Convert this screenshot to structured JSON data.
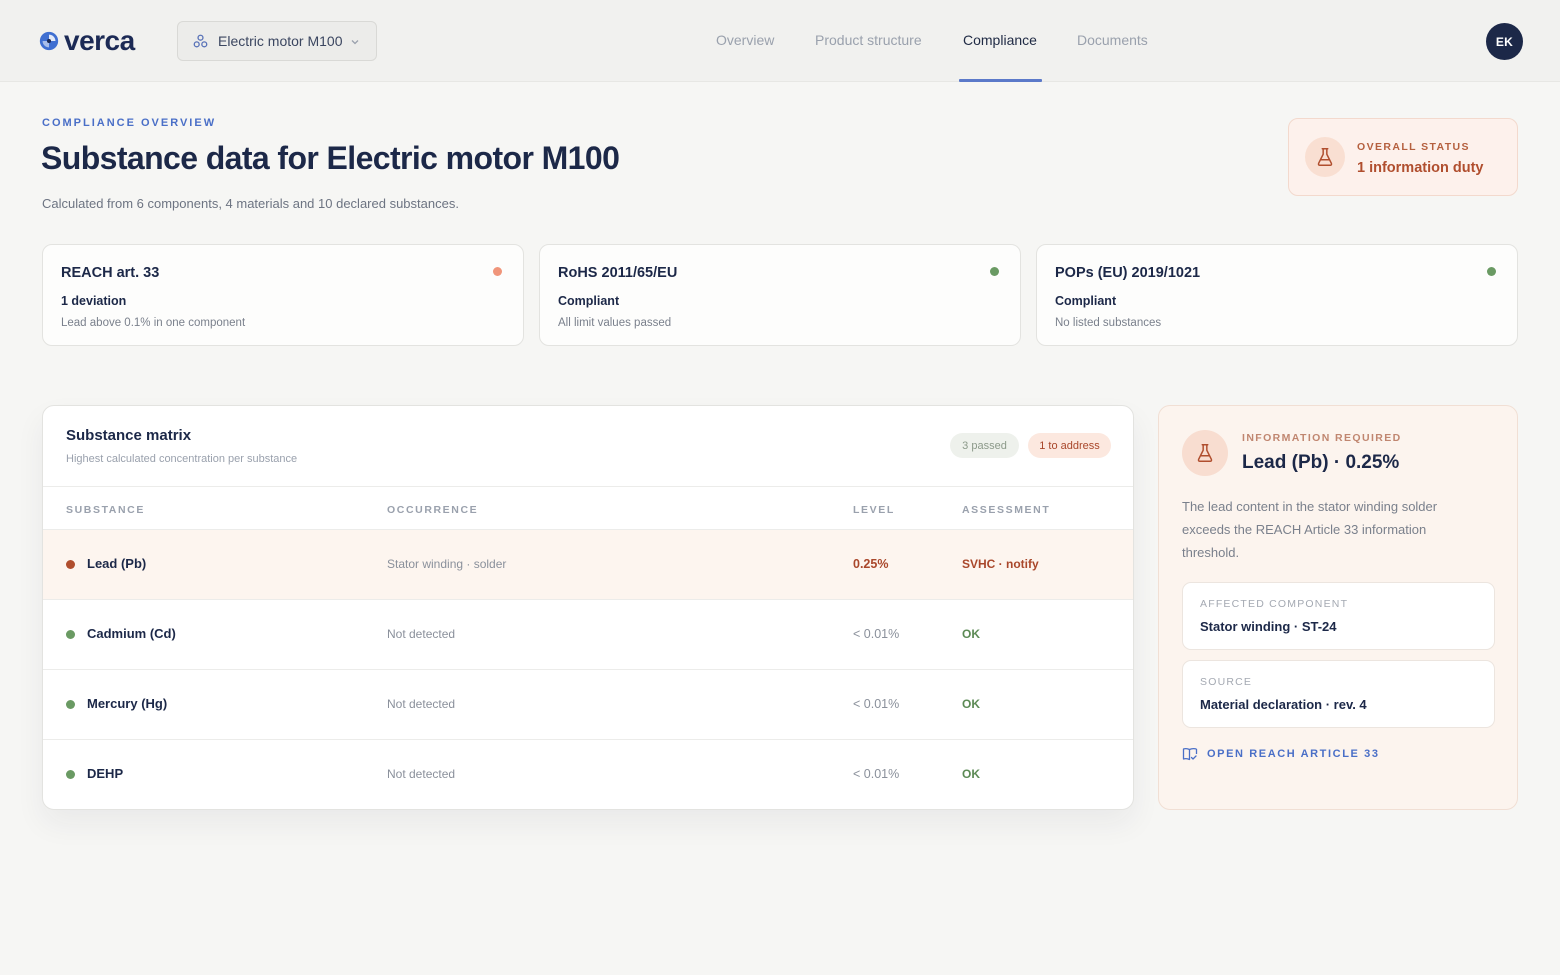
{
  "header": {
    "brand": "verca",
    "product_selector": "Electric motor M100",
    "tabs": [
      {
        "label": "Overview",
        "active": false
      },
      {
        "label": "Product structure",
        "active": false
      },
      {
        "label": "Compliance",
        "active": true
      },
      {
        "label": "Documents",
        "active": false
      }
    ],
    "avatar_initials": "EK"
  },
  "page": {
    "eyebrow": "COMPLIANCE OVERVIEW",
    "title": "Substance data for Electric motor M100",
    "subtitle": "Calculated from 6 components, 4 materials and 10 declared substances."
  },
  "overall_status": {
    "label": "OVERALL STATUS",
    "value": "1 information duty",
    "icon": "flask-icon"
  },
  "regulations": [
    {
      "name": "REACH art. 33",
      "status": "1 deviation",
      "detail": "Lead above 0.1% in one component",
      "dot_color": "#f0957a"
    },
    {
      "name": "RoHS 2011/65/EU",
      "status": "Compliant",
      "detail": "All limit values passed",
      "dot_color": "#6a9a63"
    },
    {
      "name": "POPs (EU) 2019/1021",
      "status": "Compliant",
      "detail": "No listed substances",
      "dot_color": "#6a9a63"
    }
  ],
  "matrix": {
    "title": "Substance matrix",
    "subtitle": "Highest calculated concentration per substance",
    "badge_passed": "3 passed",
    "badge_address": "1 to address",
    "columns": [
      "SUBSTANCE",
      "OCCURRENCE",
      "LEVEL",
      "ASSESSMENT"
    ],
    "rows": [
      {
        "substance": "Lead (Pb)",
        "occurrence": "Stator winding · solder",
        "level": "0.25%",
        "assessment": "SVHC · notify",
        "dot_color": "#b04e2e",
        "level_color": "#a9472b",
        "assessment_color": "#a9472b"
      },
      {
        "substance": "Cadmium (Cd)",
        "occurrence": "Not detected",
        "level": "< 0.01%",
        "assessment": "OK",
        "dot_color": "#6a9a63",
        "level_color": "#8a909b",
        "assessment_color": "#5c8a55"
      },
      {
        "substance": "Mercury (Hg)",
        "occurrence": "Not detected",
        "level": "< 0.01%",
        "assessment": "OK",
        "dot_color": "#6a9a63",
        "level_color": "#8a909b",
        "assessment_color": "#5c8a55"
      },
      {
        "substance": "DEHP",
        "occurrence": "Not detected",
        "level": "< 0.01%",
        "assessment": "OK",
        "dot_color": "#6a9a63",
        "level_color": "#8a909b",
        "assessment_color": "#5c8a55"
      }
    ]
  },
  "detail": {
    "eyebrow": "INFORMATION REQUIRED",
    "title": "Lead (Pb) · 0.25%",
    "description": "The lead content in the stator winding solder exceeds the REACH Article 33 information threshold.",
    "affected_label": "AFFECTED COMPONENT",
    "affected_value": "Stator winding · ST-24",
    "source_label": "SOURCE",
    "source_value": "Material declaration · rev. 4",
    "link": "OPEN REACH ARTICLE 33",
    "icon": "flask-icon"
  },
  "colors": {
    "accent": "#4a6fc7",
    "navy": "#1c2848",
    "warning": "#a9472b",
    "ok": "#6a9a63"
  }
}
